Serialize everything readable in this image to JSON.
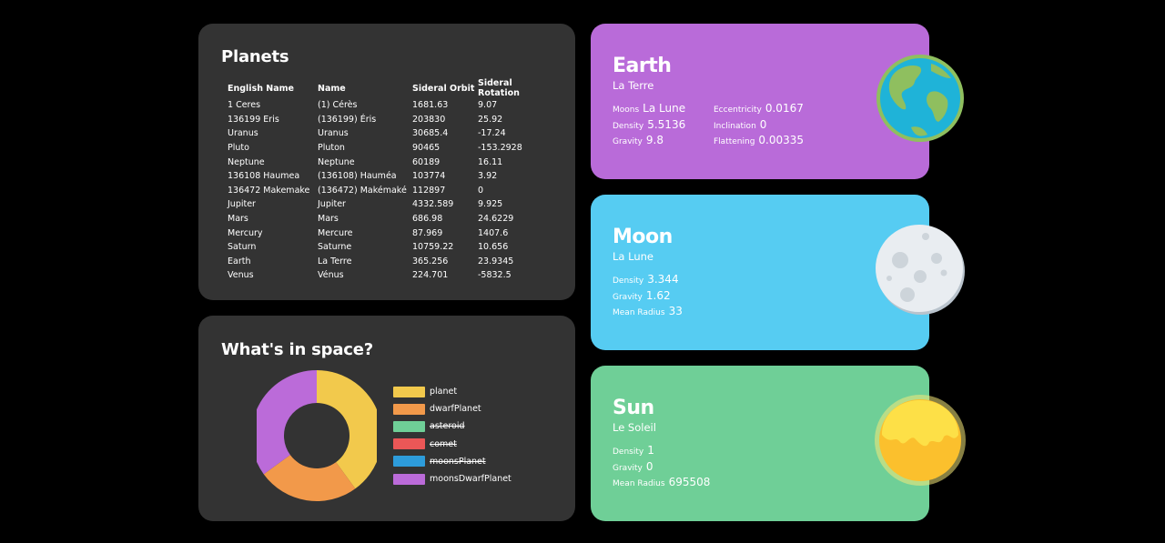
{
  "planets": {
    "title": "Planets",
    "columns": [
      "English Name",
      "Name",
      "Sideral Orbit",
      "Sideral Rotation"
    ],
    "rows": [
      [
        "1 Ceres",
        "(1) Cérès",
        "1681.63",
        "9.07"
      ],
      [
        "136199 Eris",
        "(136199) Éris",
        "203830",
        "25.92"
      ],
      [
        "Uranus",
        "Uranus",
        "30685.4",
        "-17.24"
      ],
      [
        "Pluto",
        "Pluton",
        "90465",
        "-153.2928"
      ],
      [
        "Neptune",
        "Neptune",
        "60189",
        "16.11"
      ],
      [
        "136108 Haumea",
        "(136108) Hauméa",
        "103774",
        "3.92"
      ],
      [
        "136472 Makemake",
        "(136472) Makémaké",
        "112897",
        "0"
      ],
      [
        "Jupiter",
        "Jupiter",
        "4332.589",
        "9.925"
      ],
      [
        "Mars",
        "Mars",
        "686.98",
        "24.6229"
      ],
      [
        "Mercury",
        "Mercure",
        "87.969",
        "1407.6"
      ],
      [
        "Saturn",
        "Saturne",
        "10759.22",
        "10.656"
      ],
      [
        "Earth",
        "La Terre",
        "365.256",
        "23.9345"
      ],
      [
        "Venus",
        "Vénus",
        "224.701",
        "-5832.5"
      ]
    ]
  },
  "space": {
    "title": "What's in space?",
    "legend": [
      {
        "label": "planet",
        "color": "#f2c94c",
        "struck": false
      },
      {
        "label": "dwarfPlanet",
        "color": "#f2994a",
        "struck": false
      },
      {
        "label": "asteroid",
        "color": "#6fcf97",
        "struck": true
      },
      {
        "label": "comet",
        "color": "#eb5757",
        "struck": true
      },
      {
        "label": "moonsPlanet",
        "color": "#2d9cdb",
        "struck": true
      },
      {
        "label": "moonsDwarfPlanet",
        "color": "#bb6bd9",
        "struck": false
      }
    ]
  },
  "chart_data": {
    "type": "pie",
    "title": "What's in space?",
    "categories": [
      "planet",
      "dwarfPlanet",
      "moonsDwarfPlanet"
    ],
    "values": [
      8,
      5,
      7
    ],
    "hidden_categories": [
      "asteroid",
      "comet",
      "moonsPlanet"
    ],
    "legend": "right"
  },
  "earth": {
    "title": "Earth",
    "subtitle": "La Terre",
    "icon": "earth-globe-icon",
    "color": "#b96bd9",
    "stats_left": [
      {
        "label": "Moons",
        "value": "La Lune"
      },
      {
        "label": "Density",
        "value": "5.5136"
      },
      {
        "label": "Gravity",
        "value": "9.8"
      }
    ],
    "stats_right": [
      {
        "label": "Eccentricity",
        "value": "0.0167"
      },
      {
        "label": "Inclination",
        "value": "0"
      },
      {
        "label": "Flattening",
        "value": "0.00335"
      }
    ]
  },
  "moon": {
    "title": "Moon",
    "subtitle": "La Lune",
    "icon": "moon-icon",
    "color": "#56ccf2",
    "stats": [
      {
        "label": "Density",
        "value": "3.344"
      },
      {
        "label": "Gravity",
        "value": "1.62"
      },
      {
        "label": "Mean Radius",
        "value": "33"
      }
    ]
  },
  "sun": {
    "title": "Sun",
    "subtitle": "Le Soleil",
    "icon": "sun-icon",
    "color": "#6fcf97",
    "stats": [
      {
        "label": "Density",
        "value": "1"
      },
      {
        "label": "Gravity",
        "value": "0"
      },
      {
        "label": "Mean Radius",
        "value": "695508"
      }
    ]
  }
}
